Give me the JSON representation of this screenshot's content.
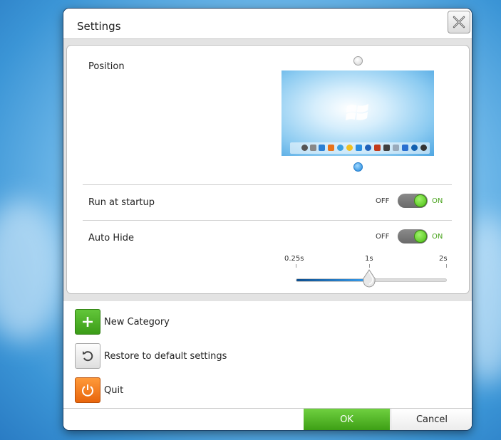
{
  "dialog": {
    "title": "Settings",
    "close_icon": "close-icon"
  },
  "position": {
    "label": "Position",
    "options": [
      {
        "name": "top",
        "selected": false
      },
      {
        "name": "bottom",
        "selected": true
      }
    ]
  },
  "startup": {
    "label": "Run at startup",
    "off_label": "OFF",
    "on_label": "ON",
    "enabled": true
  },
  "auto_hide": {
    "label": "Auto Hide",
    "off_label": "OFF",
    "on_label": "ON",
    "enabled": true,
    "slider": {
      "ticks": [
        "0.25s",
        "1s",
        "2s"
      ],
      "value_seconds": 1
    }
  },
  "actions": [
    {
      "label": "New Category",
      "icon": "plus-icon",
      "color": "#4caf28"
    },
    {
      "label": "Restore to default settings",
      "icon": "undo-icon",
      "color": "#e6e6e6"
    },
    {
      "label": "Quit",
      "icon": "power-icon",
      "color": "#f07a1c"
    }
  ],
  "footer": {
    "ok_label": "OK",
    "cancel_label": "Cancel"
  },
  "colors": {
    "accent_green": "#4caf28",
    "accent_orange": "#f07a1c",
    "slider_blue": "#1e78c8"
  }
}
